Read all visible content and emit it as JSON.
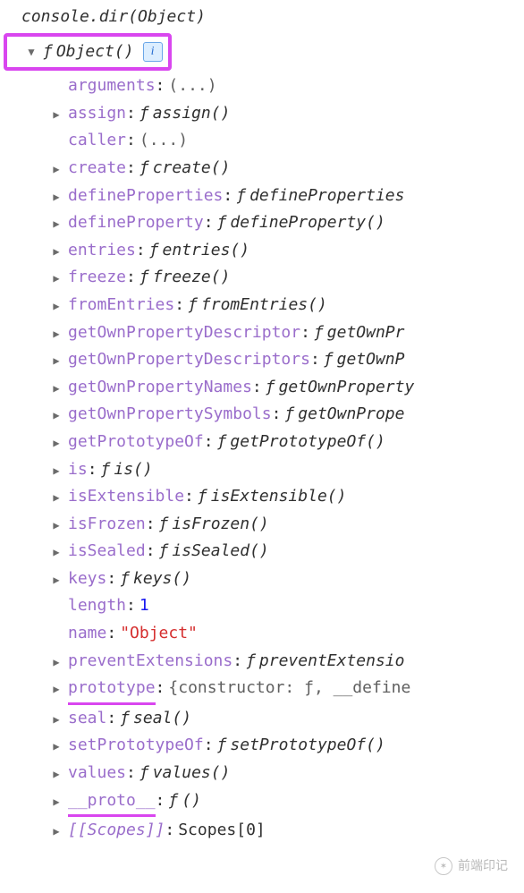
{
  "input": "console.dir(Object)",
  "root": {
    "sig": "Object()",
    "f": "ƒ"
  },
  "props": [
    {
      "key": "arguments",
      "kind": "plain",
      "value": "(...)",
      "expandable": false
    },
    {
      "key": "assign",
      "kind": "fn",
      "fn": "assign()",
      "expandable": true
    },
    {
      "key": "caller",
      "kind": "plain",
      "value": "(...)",
      "expandable": false
    },
    {
      "key": "create",
      "kind": "fn",
      "fn": "create()",
      "expandable": true
    },
    {
      "key": "defineProperties",
      "kind": "fn",
      "fn": "defineProperties",
      "expandable": true
    },
    {
      "key": "defineProperty",
      "kind": "fn",
      "fn": "defineProperty()",
      "expandable": true
    },
    {
      "key": "entries",
      "kind": "fn",
      "fn": "entries()",
      "expandable": true
    },
    {
      "key": "freeze",
      "kind": "fn",
      "fn": "freeze()",
      "expandable": true
    },
    {
      "key": "fromEntries",
      "kind": "fn",
      "fn": "fromEntries()",
      "expandable": true
    },
    {
      "key": "getOwnPropertyDescriptor",
      "kind": "fn",
      "fn": "getOwnPr",
      "expandable": true
    },
    {
      "key": "getOwnPropertyDescriptors",
      "kind": "fn",
      "fn": "getOwnP",
      "expandable": true
    },
    {
      "key": "getOwnPropertyNames",
      "kind": "fn",
      "fn": "getOwnProperty",
      "expandable": true
    },
    {
      "key": "getOwnPropertySymbols",
      "kind": "fn",
      "fn": "getOwnPrope",
      "expandable": true
    },
    {
      "key": "getPrototypeOf",
      "kind": "fn",
      "fn": "getPrototypeOf()",
      "expandable": true
    },
    {
      "key": "is",
      "kind": "fn",
      "fn": "is()",
      "expandable": true
    },
    {
      "key": "isExtensible",
      "kind": "fn",
      "fn": "isExtensible()",
      "expandable": true
    },
    {
      "key": "isFrozen",
      "kind": "fn",
      "fn": "isFrozen()",
      "expandable": true
    },
    {
      "key": "isSealed",
      "kind": "fn",
      "fn": "isSealed()",
      "expandable": true
    },
    {
      "key": "keys",
      "kind": "fn",
      "fn": "keys()",
      "expandable": true
    },
    {
      "key": "length",
      "kind": "num",
      "value": "1",
      "expandable": false
    },
    {
      "key": "name",
      "kind": "str",
      "value": "\"Object\"",
      "expandable": false
    },
    {
      "key": "preventExtensions",
      "kind": "fn",
      "fn": "preventExtensio",
      "expandable": true
    },
    {
      "key": "prototype",
      "kind": "obj",
      "value": "{constructor: ƒ, __define",
      "expandable": true,
      "underline": true
    },
    {
      "key": "seal",
      "kind": "fn",
      "fn": "seal()",
      "expandable": true
    },
    {
      "key": "setPrototypeOf",
      "kind": "fn",
      "fn": "setPrototypeOf()",
      "expandable": true
    },
    {
      "key": "values",
      "kind": "fn",
      "fn": "values()",
      "expandable": true
    },
    {
      "key": "__proto__",
      "kind": "fn",
      "fn": "()",
      "expandable": true,
      "underline": true
    },
    {
      "key": "[[Scopes]]",
      "kind": "scopes",
      "value": "Scopes[0]",
      "expandable": true
    }
  ],
  "watermark": "前端印记"
}
